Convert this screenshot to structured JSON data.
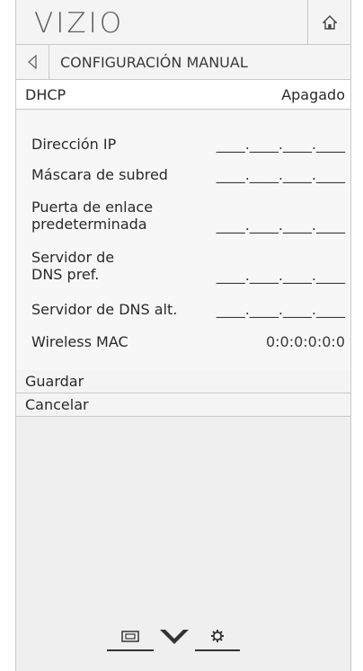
{
  "header": {
    "logo_text": "VIZIO",
    "home_icon": "home-icon"
  },
  "nav": {
    "back_icon": "back-arrow-icon",
    "title": "CONFIGURACIÓN MANUAL"
  },
  "dhcp": {
    "label": "DHCP",
    "value": "Apagado"
  },
  "fields": [
    {
      "label": "Dirección IP",
      "value": "____.____.____.____"
    },
    {
      "label": "Máscara de subred",
      "value": "____.____.____.____"
    },
    {
      "label": "Puerta de enlace predeterminada",
      "value": "____.____.____.____"
    },
    {
      "label": "Servidor de DNS pref.",
      "value": "____.____.____.____"
    },
    {
      "label": "Servidor de DNS alt.",
      "value": "____.____.____.____"
    },
    {
      "label": "Wireless MAC",
      "value": "0:0:0:0:0:0"
    }
  ],
  "actions": {
    "save": "Guardar",
    "cancel": "Cancelar"
  },
  "bottom_bar": {
    "icons": [
      "screen-icon",
      "chevron-down-icon",
      "gear-icon"
    ]
  }
}
